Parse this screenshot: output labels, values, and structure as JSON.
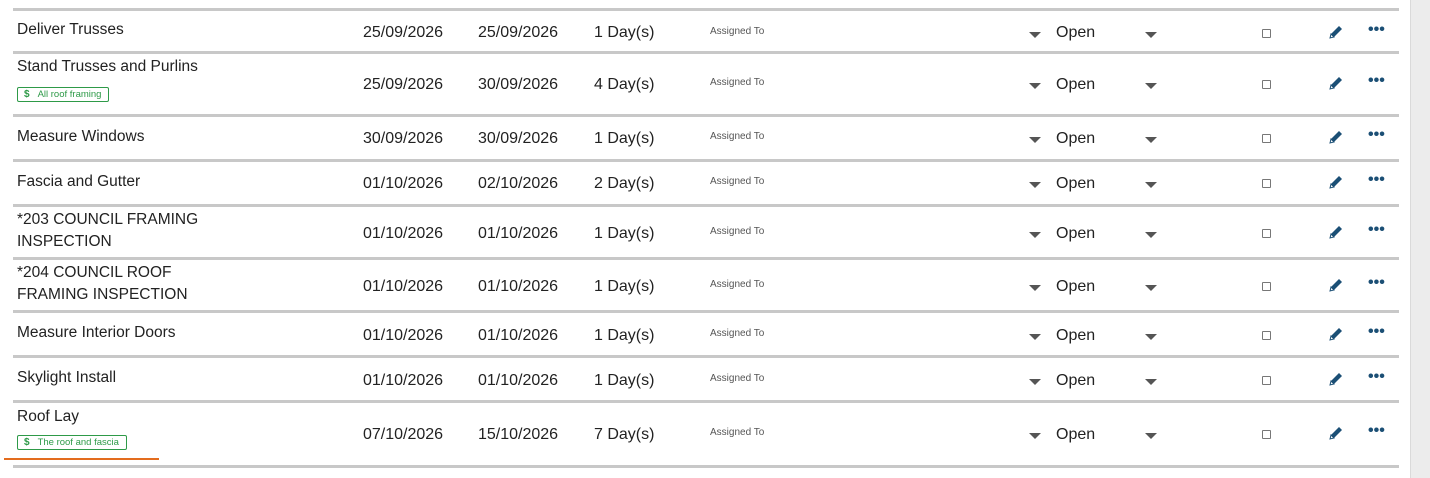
{
  "assigned_placeholder": "Assigned To",
  "colors": {
    "tag": "#2e9a48",
    "icon": "#1b4f75",
    "underline": "#e36c1e"
  },
  "rows": [
    {
      "name": "Deliver Trusses",
      "start": "25/09/2026",
      "end": "25/09/2026",
      "duration": "1 Day(s)",
      "status": "Open",
      "tag": ""
    },
    {
      "name": "Stand Trusses and Purlins",
      "start": "25/09/2026",
      "end": "30/09/2026",
      "duration": "4 Day(s)",
      "status": "Open",
      "tag": "All roof framing"
    },
    {
      "name": "Measure Windows",
      "start": "30/09/2026",
      "end": "30/09/2026",
      "duration": "1 Day(s)",
      "status": "Open",
      "tag": ""
    },
    {
      "name": "Fascia and Gutter",
      "start": "01/10/2026",
      "end": "02/10/2026",
      "duration": "2 Day(s)",
      "status": "Open",
      "tag": ""
    },
    {
      "name": "*203 COUNCIL FRAMING INSPECTION",
      "start": "01/10/2026",
      "end": "01/10/2026",
      "duration": "1 Day(s)",
      "status": "Open",
      "tag": ""
    },
    {
      "name": "*204 COUNCIL ROOF FRAMING INSPECTION",
      "start": "01/10/2026",
      "end": "01/10/2026",
      "duration": "1 Day(s)",
      "status": "Open",
      "tag": ""
    },
    {
      "name": "Measure Interior Doors",
      "start": "01/10/2026",
      "end": "01/10/2026",
      "duration": "1 Day(s)",
      "status": "Open",
      "tag": ""
    },
    {
      "name": "Skylight Install",
      "start": "01/10/2026",
      "end": "01/10/2026",
      "duration": "1 Day(s)",
      "status": "Open",
      "tag": ""
    },
    {
      "name": "Roof Lay",
      "start": "07/10/2026",
      "end": "15/10/2026",
      "duration": "7 Day(s)",
      "status": "Open",
      "tag": "The roof and fascia"
    }
  ]
}
